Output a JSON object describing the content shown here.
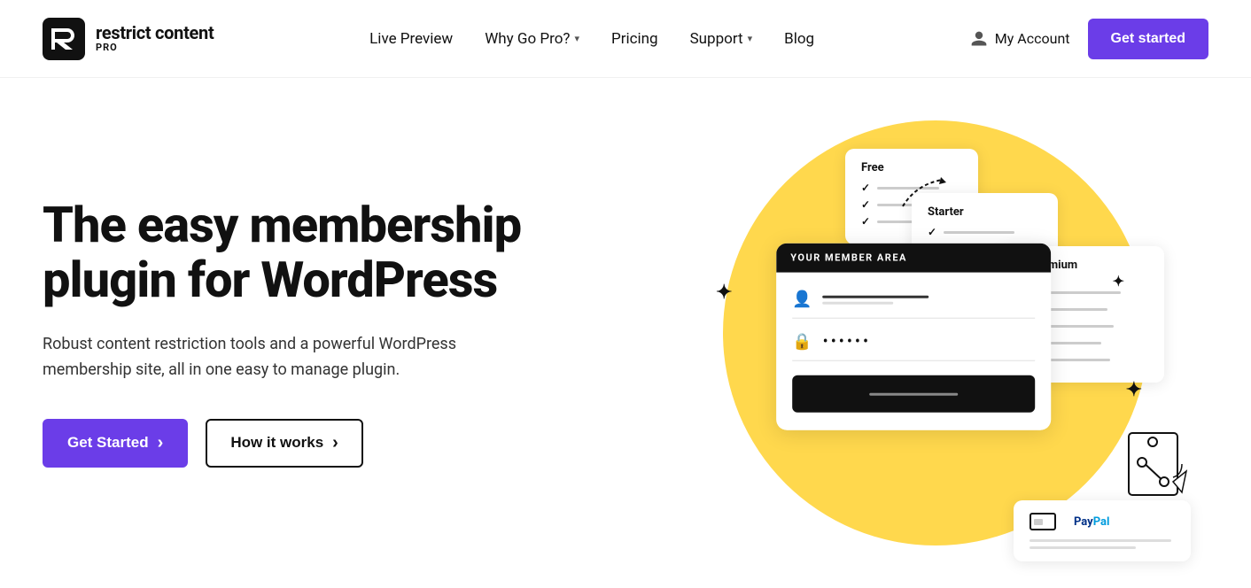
{
  "header": {
    "logo_main": "restrict content",
    "logo_pro": "PRO",
    "nav": [
      {
        "label": "Live Preview",
        "has_dropdown": false
      },
      {
        "label": "Why Go Pro?",
        "has_dropdown": true
      },
      {
        "label": "Pricing",
        "has_dropdown": false
      },
      {
        "label": "Support",
        "has_dropdown": true
      },
      {
        "label": "Blog",
        "has_dropdown": false
      }
    ],
    "my_account_label": "My Account",
    "get_started_label": "Get started"
  },
  "hero": {
    "title": "The easy membership plugin for WordPress",
    "description": "Robust content restriction tools and a powerful WordPress membership site, all in one easy to manage plugin.",
    "btn_primary": "Get Started",
    "btn_primary_arrow": "›",
    "btn_secondary": "How it works",
    "btn_secondary_arrow": "›"
  },
  "illustration": {
    "member_area_header": "YOUR MEMBER AREA",
    "price_cards": [
      {
        "id": "free",
        "title": "Free",
        "rows": 3
      },
      {
        "id": "starter",
        "title": "Starter",
        "rows": 3
      },
      {
        "id": "premium",
        "title": "Premium",
        "rows": 5
      }
    ],
    "payment_label": "PayPal"
  }
}
